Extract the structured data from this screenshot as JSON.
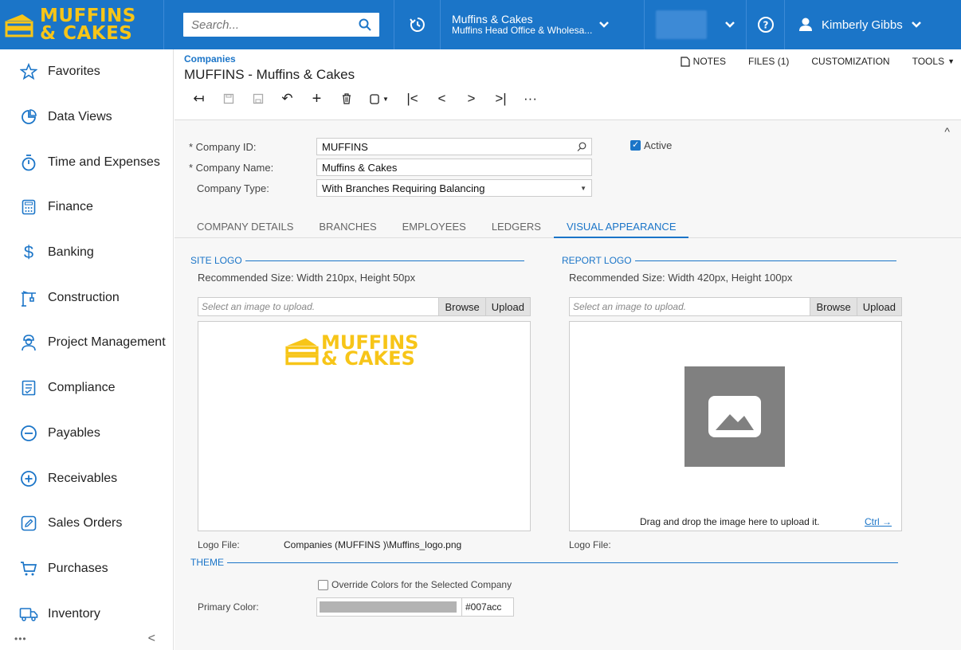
{
  "brand": {
    "line1": "MUFFINS",
    "line2": "& CAKES",
    "accent": "#f7c518",
    "primary": "#1b75c8"
  },
  "search": {
    "placeholder": "Search..."
  },
  "company_selector": {
    "name": "Muffins & Cakes",
    "branch": "Muffins Head Office & Wholesa..."
  },
  "user": {
    "name": "Kimberly Gibbs"
  },
  "sidebar": {
    "items": [
      {
        "label": "Favorites",
        "icon": "star-icon"
      },
      {
        "label": "Data Views",
        "icon": "pie-chart-icon"
      },
      {
        "label": "Time and Expenses",
        "icon": "stopwatch-icon"
      },
      {
        "label": "Finance",
        "icon": "calculator-icon"
      },
      {
        "label": "Banking",
        "icon": "dollar-icon"
      },
      {
        "label": "Construction",
        "icon": "crane-icon"
      },
      {
        "label": "Project Management",
        "icon": "worker-icon"
      },
      {
        "label": "Compliance",
        "icon": "checklist-icon"
      },
      {
        "label": "Payables",
        "icon": "minus-circle-icon"
      },
      {
        "label": "Receivables",
        "icon": "plus-circle-icon"
      },
      {
        "label": "Sales Orders",
        "icon": "edit-icon"
      },
      {
        "label": "Purchases",
        "icon": "cart-icon"
      },
      {
        "label": "Inventory",
        "icon": "truck-icon"
      }
    ],
    "more": "•••",
    "collapse": "<"
  },
  "header": {
    "breadcrumb": "Companies",
    "title": "MUFFINS - Muffins & Cakes",
    "links": {
      "notes": "NOTES",
      "files": "FILES (1)",
      "customization": "CUSTOMIZATION",
      "tools": "TOOLS"
    }
  },
  "form": {
    "company_id_label": "* Company ID:",
    "company_id": "MUFFINS",
    "company_name_label": "* Company Name:",
    "company_name": "Muffins & Cakes",
    "company_type_label": "Company Type:",
    "company_type": "With Branches Requiring Balancing",
    "active_label": "Active"
  },
  "tabs": [
    "COMPANY DETAILS",
    "BRANCHES",
    "EMPLOYEES",
    "LEDGERS",
    "VISUAL APPEARANCE"
  ],
  "site_logo": {
    "title": "SITE LOGO",
    "hint": "Recommended Size: Width 210px, Height 50px",
    "placeholder": "Select an image to upload.",
    "browse": "Browse",
    "upload": "Upload",
    "logo_file_label": "Logo File:",
    "logo_file": "Companies (MUFFINS   )\\Muffins_logo.png"
  },
  "report_logo": {
    "title": "REPORT LOGO",
    "hint": "Recommended Size: Width 420px, Height 100px",
    "placeholder": "Select an image to upload.",
    "browse": "Browse",
    "upload": "Upload",
    "drop_text": "Drag and drop the image here to upload it.",
    "ctrl_link": "Ctrl →",
    "logo_file_label": "Logo File:"
  },
  "theme": {
    "title": "THEME",
    "override_label": "Override Colors for the Selected Company",
    "primary_color_label": "Primary Color:",
    "primary_color": "#007acc"
  }
}
